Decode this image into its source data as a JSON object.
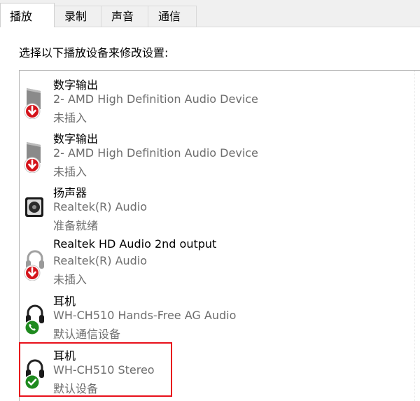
{
  "tabs": [
    {
      "label": "播放",
      "active": true
    },
    {
      "label": "录制",
      "active": false
    },
    {
      "label": "声音",
      "active": false
    },
    {
      "label": "通信",
      "active": false
    }
  ],
  "instruction": "选择以下播放设备来修改设置:",
  "devices": [
    {
      "name": "数字输出",
      "description": "2- AMD High Definition Audio Device",
      "status": "未插入",
      "icon": "digital-output-icon",
      "badge": "unplugged-badge"
    },
    {
      "name": "数字输出",
      "description": "2- AMD High Definition Audio Device",
      "status": "未插入",
      "icon": "digital-output-icon",
      "badge": "unplugged-badge"
    },
    {
      "name": "扬声器",
      "description": "Realtek(R) Audio",
      "status": "准备就绪",
      "icon": "speaker-icon",
      "badge": ""
    },
    {
      "name": "Realtek HD Audio 2nd output",
      "description": "Realtek(R) Audio",
      "status": "未插入",
      "icon": "headphones-icon",
      "badge": "unplugged-badge"
    },
    {
      "name": "耳机",
      "description": "WH-CH510 Hands-Free AG Audio",
      "status": "默认通信设备",
      "icon": "headphones-icon",
      "badge": "phone-badge"
    },
    {
      "name": "耳机",
      "description": "WH-CH510 Stereo",
      "status": "默认设备",
      "icon": "headphones-icon",
      "badge": "check-badge",
      "highlighted": true
    }
  ],
  "colors": {
    "unplugged_badge": "#d4141b",
    "default_badge": "#1e8a1e",
    "highlight_border": "#e8101b"
  }
}
